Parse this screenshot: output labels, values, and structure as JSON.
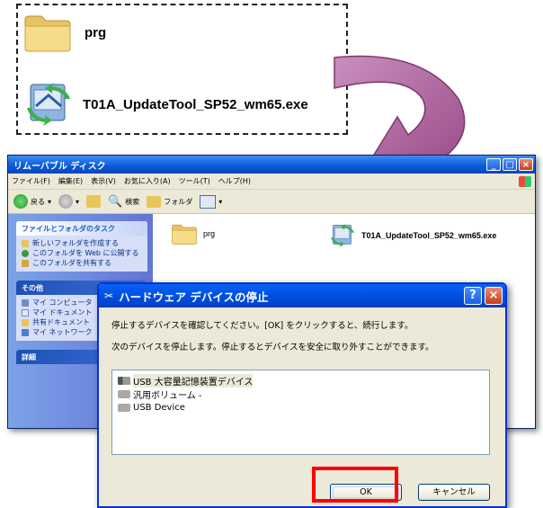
{
  "callout": {
    "folder_name": "prg",
    "exe_name": "T01A_UpdateTool_SP52_wm65.exe"
  },
  "explorer": {
    "title": "リムーバブル ディスク",
    "menu": [
      "ファイル(F)",
      "編集(E)",
      "表示(V)",
      "お気に入り(A)",
      "ツール(T)",
      "ヘルプ(H)"
    ],
    "toolbar": {
      "back": "戻る",
      "search": "検索",
      "folders": "フォルダ"
    },
    "tasks": {
      "header": "ファイルとフォルダのタスク",
      "items": [
        "新しいフォルダを作成する",
        "このフォルダを Web に公開する",
        "このフォルダを共有する"
      ]
    },
    "other": {
      "header": "その他",
      "items": [
        "マイ コンピュータ",
        "マイ ドキュメント",
        "共有ドキュメント",
        "マイ ネットワーク"
      ]
    },
    "details": {
      "header": "詳細"
    },
    "files": [
      {
        "name": "prg",
        "icon": "folder-icon"
      },
      {
        "name": "T01A_UpdateTool_SP52_wm65.exe",
        "icon": "exe-icon"
      }
    ]
  },
  "dialog": {
    "title": "ハードウェア デバイスの停止",
    "text1": "停止するデバイスを確認してください。[OK] をクリックすると、続行します。",
    "text2": "次のデバイスを停止します。停止するとデバイスを安全に取り外すことができます。",
    "devices": [
      "USB 大容量記憶装置デバイス",
      "汎用ボリューム -",
      "USB Device"
    ],
    "ok": "OK",
    "cancel": "キャンセル"
  },
  "colors": {
    "highlight": "#ff0000",
    "xp_blue": "#0a5ad9",
    "arrow": "#b05c9a"
  }
}
